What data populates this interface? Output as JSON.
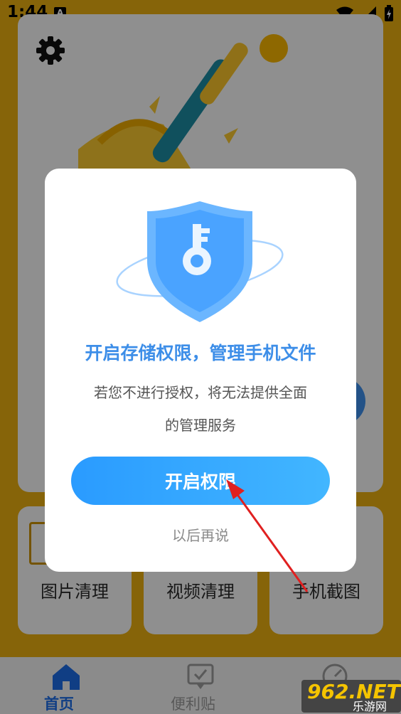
{
  "status_bar": {
    "time": "1:44",
    "notification_letter": "A"
  },
  "tiles": [
    {
      "label": "图片清理"
    },
    {
      "label": "视频清理"
    },
    {
      "label": "手机截图"
    }
  ],
  "bottom_nav": {
    "home_label": "首页",
    "notes_label": "便利贴"
  },
  "dialog": {
    "title": "开启存储权限，管理手机文件",
    "description_line1": "若您不进行授权，将无法提供全面",
    "description_line2": "的管理服务",
    "enable_button": "开启权限",
    "later_button": "以后再说"
  },
  "watermark": {
    "brand": "962.NET",
    "sub": "乐游网"
  },
  "colors": {
    "background": "#e7ac10",
    "accent_blue": "#3d8ee8",
    "button_gradient_start": "#2a9bff",
    "button_gradient_end": "#42b6ff",
    "arrow_red": "#e02020"
  }
}
